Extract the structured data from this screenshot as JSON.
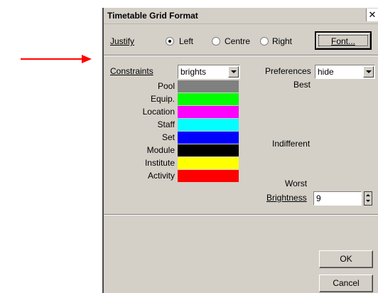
{
  "window": {
    "title": "Timetable Grid Format",
    "close_glyph": "✕"
  },
  "justify": {
    "label": "Justify",
    "options": [
      {
        "label": "Left",
        "checked": true
      },
      {
        "label": "Centre",
        "checked": false
      },
      {
        "label": "Right",
        "checked": false
      }
    ],
    "font_button": "Font..."
  },
  "constraints": {
    "label": "Constraints",
    "value": "brights"
  },
  "preferences": {
    "label": "Preferences",
    "value": "hide"
  },
  "swatches": [
    {
      "label": "Pool",
      "color": "#808080"
    },
    {
      "label": "Equip.",
      "color": "#00ff00"
    },
    {
      "label": "Location",
      "color": "#ff00ff"
    },
    {
      "label": "Staff",
      "color": "#00ffff"
    },
    {
      "label": "Set",
      "color": "#0000ff"
    },
    {
      "label": "Module",
      "color": "#000000"
    },
    {
      "label": "Institute",
      "color": "#ffff00"
    },
    {
      "label": "Activity",
      "color": "#ff0000"
    }
  ],
  "scale": {
    "best": "Best",
    "indifferent": "Indifferent",
    "worst": "Worst"
  },
  "brightness": {
    "label": "Brightness",
    "value": "9"
  },
  "buttons": {
    "ok": "OK",
    "cancel": "Cancel"
  },
  "annotation": {
    "arrow_color": "#ff0000"
  }
}
